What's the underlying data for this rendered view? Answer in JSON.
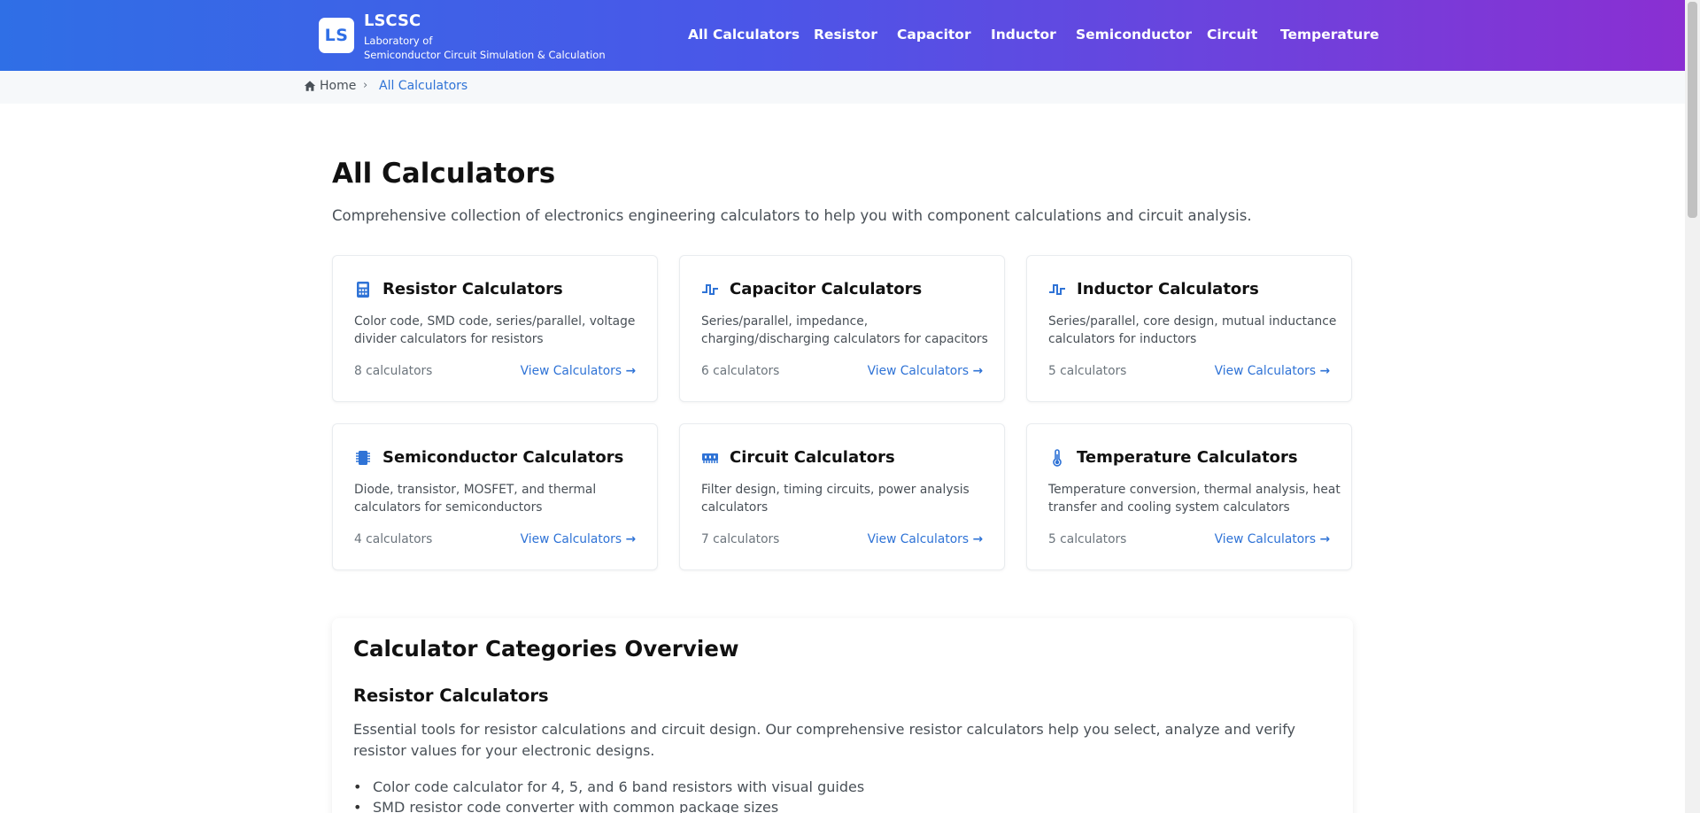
{
  "header": {
    "logo_text": "LS",
    "brand_name": "LSCSC",
    "brand_sub_line1": "Laboratory of",
    "brand_sub_line2": "Semiconductor Circuit Simulation & Calculation",
    "nav": [
      "All Calculators",
      "Resistor",
      "Capacitor",
      "Inductor",
      "Semiconductor",
      "Circuit",
      "Temperature"
    ]
  },
  "breadcrumb": {
    "home": "Home",
    "separator": "›",
    "current": "All Calculators"
  },
  "page": {
    "title": "All Calculators",
    "description": "Comprehensive collection of electronics engineering calculators to help you with component calculations and circuit analysis."
  },
  "cards": [
    {
      "icon": "calculator-icon",
      "title": "Resistor Calculators",
      "desc": "Color code, SMD code, series/parallel, voltage divider calculators for resistors",
      "count": "8 calculators",
      "link": "View Calculators"
    },
    {
      "icon": "waveform-icon",
      "title": "Capacitor Calculators",
      "desc": "Series/parallel, impedance, charging/discharging calculators for capacitors",
      "count": "6 calculators",
      "link": "View Calculators"
    },
    {
      "icon": "waveform-icon",
      "title": "Inductor Calculators",
      "desc": "Series/parallel, core design, mutual inductance calculators for inductors",
      "count": "5 calculators",
      "link": "View Calculators"
    },
    {
      "icon": "chip-icon",
      "title": "Semiconductor Calculators",
      "desc": "Diode, transistor, MOSFET, and thermal calculators for semiconductors",
      "count": "4 calculators",
      "link": "View Calculators"
    },
    {
      "icon": "memory-icon",
      "title": "Circuit Calculators",
      "desc": "Filter design, timing circuits, power analysis calculators",
      "count": "7 calculators",
      "link": "View Calculators"
    },
    {
      "icon": "thermometer-icon",
      "title": "Temperature Calculators",
      "desc": "Temperature conversion, thermal analysis, heat transfer and cooling system calculators",
      "count": "5 calculators",
      "link": "View Calculators"
    }
  ],
  "overview": {
    "title": "Calculator Categories Overview",
    "section_title": "Resistor Calculators",
    "section_text": "Essential tools for resistor calculations and circuit design. Our comprehensive resistor calculators help you select, analyze and verify resistor values for your electronic designs.",
    "items": [
      "Color code calculator for 4, 5, and 6 band resistors with visual guides",
      "SMD resistor code converter with common package sizes"
    ]
  },
  "colors": {
    "accent": "#2f73d6",
    "gradient_start": "#2f6fe6",
    "gradient_end": "#8a2fd2"
  }
}
